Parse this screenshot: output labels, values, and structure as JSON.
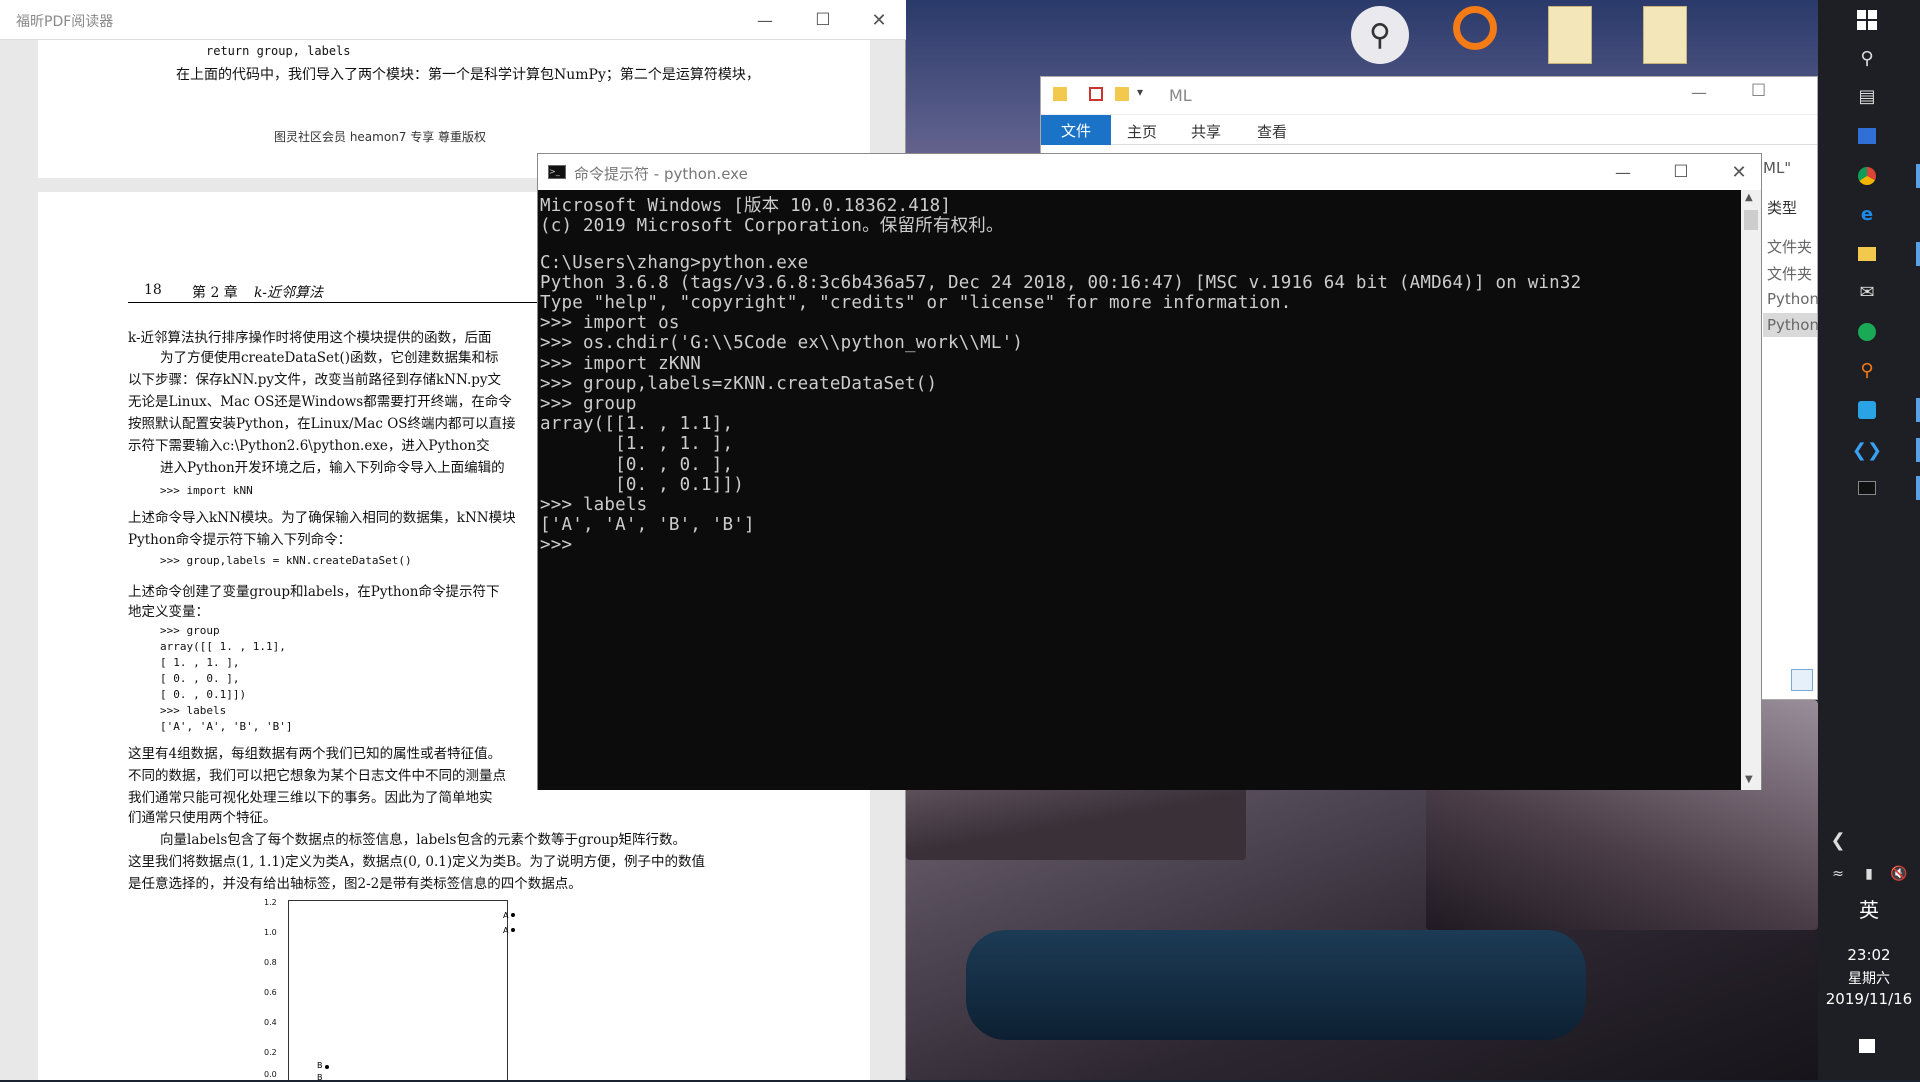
{
  "pdf": {
    "title": "福昕PDF阅读器",
    "page1_lines": [
      "return group, labels",
      "在上面的代码中，我们导入了两个模块：第一个是科学计算包NumPy；第二个是运算符模块，",
      "图灵社区会员 heamon7 专享 尊重版权"
    ],
    "header_page": "18",
    "header_chapter": "第 2 章",
    "header_title": "k-近邻算法",
    "body": [
      "k-近邻算法执行排序操作时将使用这个模块提供的函数，后面",
      "为了方便使用createDataSet()函数，它创建数据集和标",
      "以下步骤：保存kNN.py文件，改变当前路径到存储kNN.py文",
      "无论是Linux、Mac OS还是Windows都需要打开终端，在命令",
      "按照默认配置安装Python，在Linux/Mac OS终端内都可以直接",
      "示符下需要输入c:\\Python2.6\\python.exe，进入Python交",
      "进入Python开发环境之后，输入下列命令导入上面编辑的",
      ">>> import kNN",
      "上述命令导入kNN模块。为了确保输入相同的数据集，kNN模块",
      "Python命令提示符下输入下列命令：",
      ">>> group,labels = kNN.createDataSet()",
      "上述命令创建了变量group和labels，在Python命令提示符下",
      "地定义变量：",
      ">>> group",
      "array([[ 1. ,  1.1],",
      "       [ 1. ,  1. ],",
      "       [ 0. ,  0. ],",
      "       [ 0. ,  0.1]])",
      ">>> labels",
      "['A', 'A', 'B', 'B']",
      "这里有4组数据，每组数据有两个我们已知的属性或者特征值。",
      "不同的数据，我们可以把它想象为某个日志文件中不同的测量点",
      "我们通常只能可视化处理三维以下的事务。因此为了简单地实",
      "们通常只使用两个特征。",
      "向量labels包含了每个数据点的标签信息，labels包含的元素个数等于group矩阵行数。",
      "这里我们将数据点(1, 1.1)定义为类A，数据点(0, 0.1)定义为类B。为了说明方便，例子中的数值",
      "是任意选择的，并没有给出轴标签，图2-2是带有类标签信息的四个数据点。"
    ],
    "plot_yticks": [
      "1.2",
      "1.0",
      "0.8",
      "0.6",
      "0.4",
      "0.2",
      "0.0"
    ],
    "plot_labels": [
      "A",
      "A",
      "B",
      "B"
    ]
  },
  "cmd": {
    "title": "命令提示符 - python.exe",
    "lines": [
      "Microsoft Windows [版本 10.0.18362.418]",
      "(c) 2019 Microsoft Corporation。保留所有权利。",
      "",
      "C:\\Users\\zhang>python.exe",
      "Python 3.6.8 (tags/v3.6.8:3c6b436a57, Dec 24 2018, 00:16:47) [MSC v.1916 64 bit (AMD64)] on win32",
      "Type \"help\", \"copyright\", \"credits\" or \"license\" for more information.",
      ">>> import os",
      ">>> os.chdir('G:\\\\5Code ex\\\\python_work\\\\ML')",
      ">>> import zKNN",
      ">>> group,labels=zKNN.createDataSet()",
      ">>> group",
      "array([[1. , 1.1],",
      "       [1. , 1. ],",
      "       [0. , 0. ],",
      "       [0. , 0.1]])",
      ">>> labels",
      "['A', 'A', 'B', 'B']",
      ">>> "
    ]
  },
  "explorer": {
    "title": "ML",
    "tabs": [
      "文件",
      "主页",
      "共享",
      "查看"
    ],
    "path_fragment": "ML\"",
    "column_header": "类型",
    "items": [
      "文件夹",
      "文件夹",
      "Python",
      "Python"
    ]
  },
  "taskbar": {
    "ime": "英",
    "time": "23:02",
    "weekday": "星期六",
    "date": "2019/11/16"
  },
  "colors": {
    "accent": "#1a73c7",
    "console_bg": "#0c0c0c",
    "console_fg": "#cccccc"
  }
}
